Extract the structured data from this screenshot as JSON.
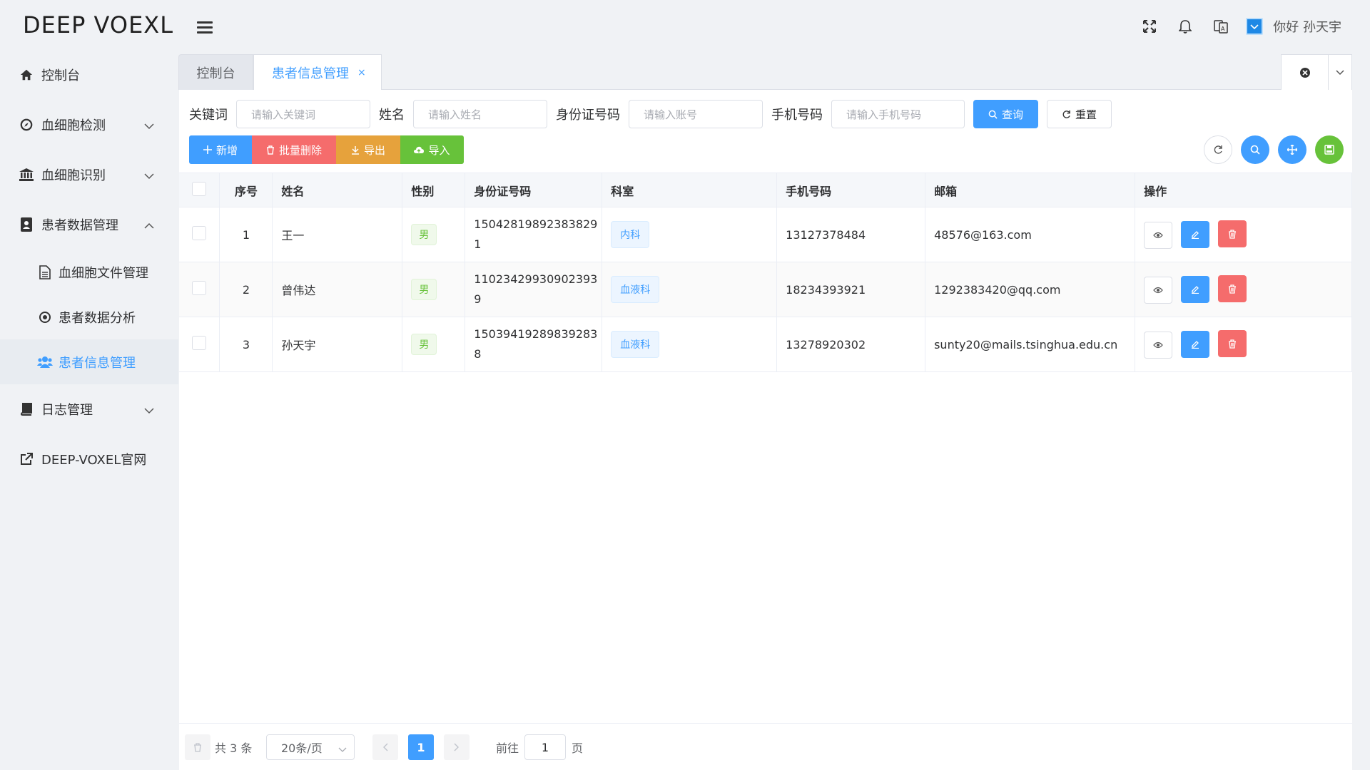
{
  "app": {
    "logo": "DEEP VOEXL",
    "greeting": "你好 孙天宇"
  },
  "sidebar": {
    "items": [
      {
        "label": "控制台",
        "icon": "home-icon"
      },
      {
        "label": "血细胞检测",
        "icon": "compass-icon"
      },
      {
        "label": "血细胞识别",
        "icon": "bank-icon"
      },
      {
        "label": "患者数据管理",
        "icon": "contact-book-icon"
      },
      {
        "label": "日志管理",
        "icon": "book-icon"
      },
      {
        "label": "DEEP-VOXEL官网",
        "icon": "external-link-icon"
      }
    ],
    "subitems": [
      {
        "label": "血细胞文件管理",
        "icon": "document-icon"
      },
      {
        "label": "患者数据分析",
        "icon": "target-icon"
      },
      {
        "label": "患者信息管理",
        "icon": "users-icon",
        "active": true
      }
    ]
  },
  "tabs": [
    {
      "label": "控制台"
    },
    {
      "label": "患者信息管理",
      "active": true,
      "close": "×"
    }
  ],
  "search": {
    "keyword_label": "关键词",
    "keyword_placeholder": "请输入关键词",
    "name_label": "姓名",
    "name_placeholder": "请输入姓名",
    "id_label": "身份证号码",
    "id_placeholder": "请输入账号",
    "phone_label": "手机号码",
    "phone_placeholder": "请输入手机号码",
    "query_button": "查询",
    "reset_button": "重置"
  },
  "toolbar": {
    "add": "新增",
    "batch_delete": "批量删除",
    "export": "导出",
    "import": "导入"
  },
  "table": {
    "headers": [
      "序号",
      "姓名",
      "性别",
      "身份证号码",
      "科室",
      "手机号码",
      "邮箱",
      "操作"
    ],
    "rows": [
      {
        "index": "1",
        "name": "王一",
        "gender": "男",
        "id_line1": "15042819892383829",
        "id_line2": "1",
        "dept": "内科",
        "phone": "13127378484",
        "email": "48576@163.com"
      },
      {
        "index": "2",
        "name": "曾伟达",
        "gender": "男",
        "id_line1": "11023429930902393",
        "id_line2": "9",
        "dept": "血液科",
        "phone": "18234393921",
        "email": "1292383420@qq.com"
      },
      {
        "index": "3",
        "name": "孙天宇",
        "gender": "男",
        "id_line1": "15039419289839283",
        "id_line2": "8",
        "dept": "血液科",
        "phone": "13278920302",
        "email": "sunty20@mails.tsinghua.edu.cn"
      }
    ]
  },
  "pagination": {
    "total": "共 3 条",
    "page_size": "20条/页",
    "current_page": "1",
    "goto_label": "前往",
    "goto_value": "1",
    "page_suffix": "页"
  },
  "colors": {
    "primary": "#409eff",
    "danger": "#f56c6c",
    "warning": "#e6a23c",
    "success": "#67c23a"
  }
}
